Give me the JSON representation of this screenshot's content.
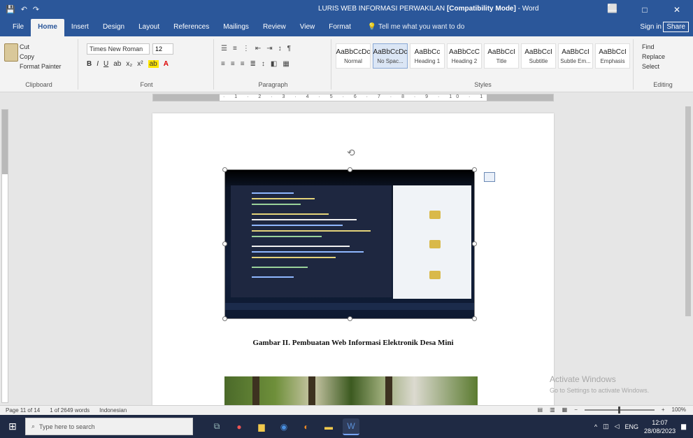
{
  "window": {
    "quick_access": [
      "Save",
      "Undo",
      "Redo"
    ],
    "doc_title": "LURIS WEB INFORMASI PERWAKILAN",
    "mode": "[Compatibility Mode]",
    "app_name": "Word",
    "ctrls": [
      "—",
      "□",
      "✕"
    ]
  },
  "tabs": [
    "File",
    "Home",
    "Insert",
    "Design",
    "Layout",
    "References",
    "Mailings",
    "Review",
    "View",
    "Format"
  ],
  "active_tab_index": 1,
  "tell_me": "Tell me what you want to do",
  "sign_in": "Sign in",
  "share": "Share",
  "ribbon": {
    "clipboard": {
      "items": [
        "Cut",
        "Copy",
        "Format Painter"
      ],
      "paste": "Paste",
      "label": "Clipboard"
    },
    "font": {
      "name": "Times New Roman",
      "size": "12",
      "label": "Font"
    },
    "paragraph": {
      "label": "Paragraph"
    },
    "styles": {
      "items": [
        {
          "preview": "AaBbCcDc",
          "name": "Normal"
        },
        {
          "preview": "AaBbCcDc",
          "name": "No Spac..."
        },
        {
          "preview": "AaBbCc",
          "name": "Heading 1"
        },
        {
          "preview": "AaBbCcC",
          "name": "Heading 2"
        },
        {
          "preview": "AaBbCcI",
          "name": "Title"
        },
        {
          "preview": "AaBbCcI",
          "name": "Subtitle"
        },
        {
          "preview": "AaBbCcI",
          "name": "Subtle Em..."
        },
        {
          "preview": "AaBbCcI",
          "name": "Emphasis"
        }
      ],
      "selected_index": 1,
      "label": "Styles"
    },
    "editing": {
      "items": [
        "Find",
        "Replace",
        "Select"
      ],
      "label": "Editing"
    }
  },
  "document": {
    "caption": "Gambar II. Pembuatan Web Informasi Elektronik Desa Mini"
  },
  "watermark": {
    "line1": "Activate Windows",
    "line2": "Go to Settings to activate Windows."
  },
  "statusbar": {
    "page": "Page 11 of 14",
    "words": "1 of 2649 words",
    "lang": "Indonesian",
    "zoom": "100%"
  },
  "taskbar": {
    "search_placeholder": "Type here to search",
    "pinned": [
      "Edge",
      "File Explorer",
      "Chrome",
      "Browser",
      "Store",
      "Word"
    ],
    "time": "12:07",
    "date": "28/08/2023",
    "lang": "ENG"
  },
  "colors": {
    "accent": "#2b579a",
    "taskbar": "#1f2a44"
  }
}
